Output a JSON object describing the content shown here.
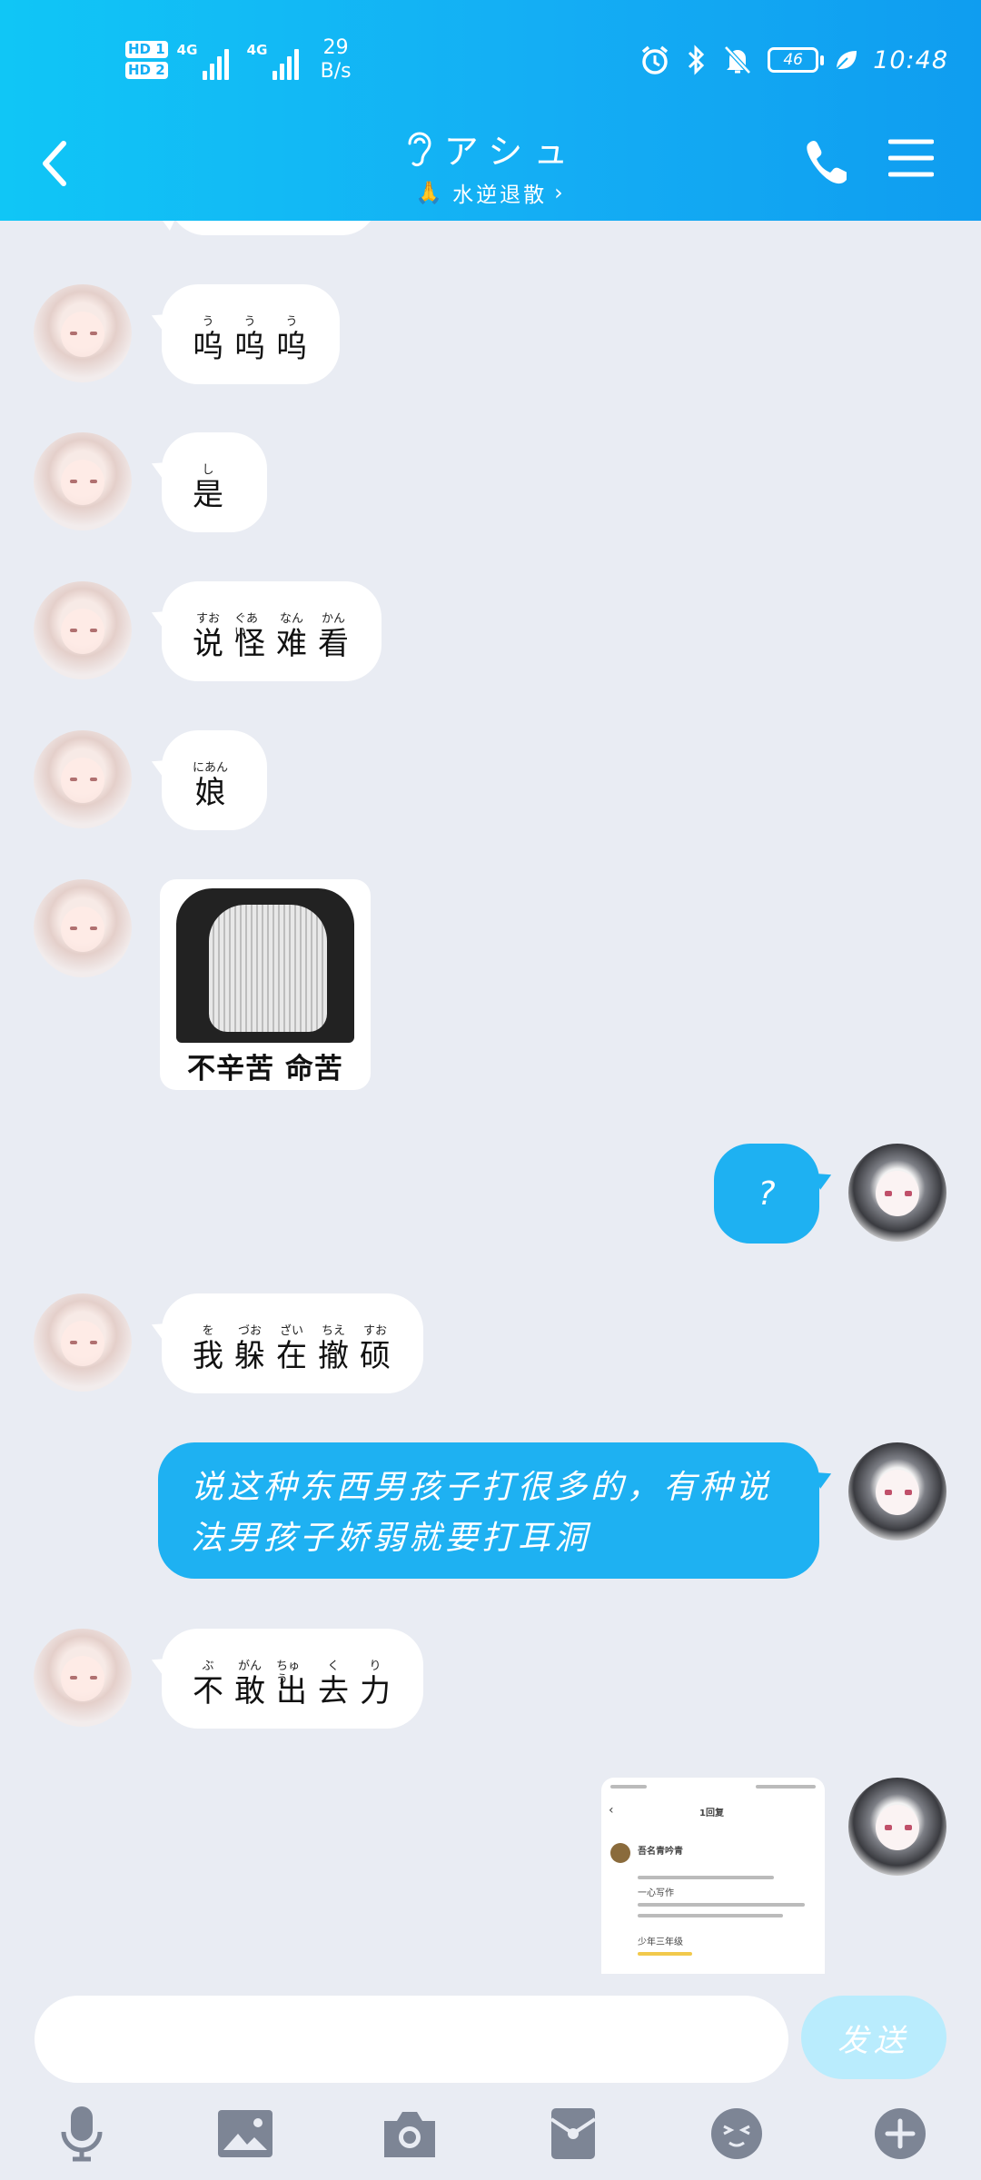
{
  "status_bar": {
    "sim1": "HD 1",
    "sim2": "HD 2",
    "net1": "4G",
    "net2": "4G",
    "data_rate_value": "29",
    "data_rate_unit": "B/s",
    "battery": "46",
    "time": "10:48"
  },
  "header": {
    "title": "アシュ",
    "subtitle": "水逆退散",
    "accent_color": "#14aef4"
  },
  "messages": [
    {
      "side": "in",
      "type": "ruby",
      "chars": [
        "呜",
        "呜",
        "呜"
      ],
      "ruby": [
        "う",
        "う",
        "う"
      ]
    },
    {
      "side": "in",
      "type": "ruby",
      "chars": [
        "是"
      ],
      "ruby": [
        "し"
      ]
    },
    {
      "side": "in",
      "type": "ruby",
      "chars": [
        "说",
        "怪",
        "难",
        "看"
      ],
      "ruby": [
        "すお",
        "ぐあい",
        "なん",
        "かん"
      ]
    },
    {
      "side": "in",
      "type": "ruby",
      "chars": [
        "娘"
      ],
      "ruby": [
        "にあん"
      ]
    },
    {
      "side": "in",
      "type": "sticker",
      "caption": "不辛苦 命苦"
    },
    {
      "side": "out",
      "type": "text",
      "text": "?"
    },
    {
      "side": "in",
      "type": "ruby",
      "chars": [
        "我",
        "躲",
        "在",
        "撤",
        "硕"
      ],
      "ruby": [
        "を",
        "づお",
        "ざい",
        "ちえ",
        "すお"
      ]
    },
    {
      "side": "out",
      "type": "text",
      "text": "说这种东西男孩子打很多的，有种说法男孩子娇弱就要打耳洞"
    },
    {
      "side": "in",
      "type": "ruby",
      "chars": [
        "不",
        "敢",
        "出",
        "去",
        "力"
      ],
      "ruby": [
        "ぶ",
        "がん",
        "ちゅう",
        "く",
        "り"
      ]
    },
    {
      "side": "out",
      "type": "image",
      "thumb_title": "1回复",
      "thumb_lines": [
        "吾名青吟青",
        "一心写作",
        "少年三年级"
      ]
    }
  ],
  "composer": {
    "placeholder": "",
    "send_label": "发送"
  },
  "toolbar": {
    "icons": [
      "microphone-icon",
      "image-icon",
      "camera-icon",
      "red-packet-icon",
      "emoji-icon",
      "plus-icon"
    ]
  }
}
